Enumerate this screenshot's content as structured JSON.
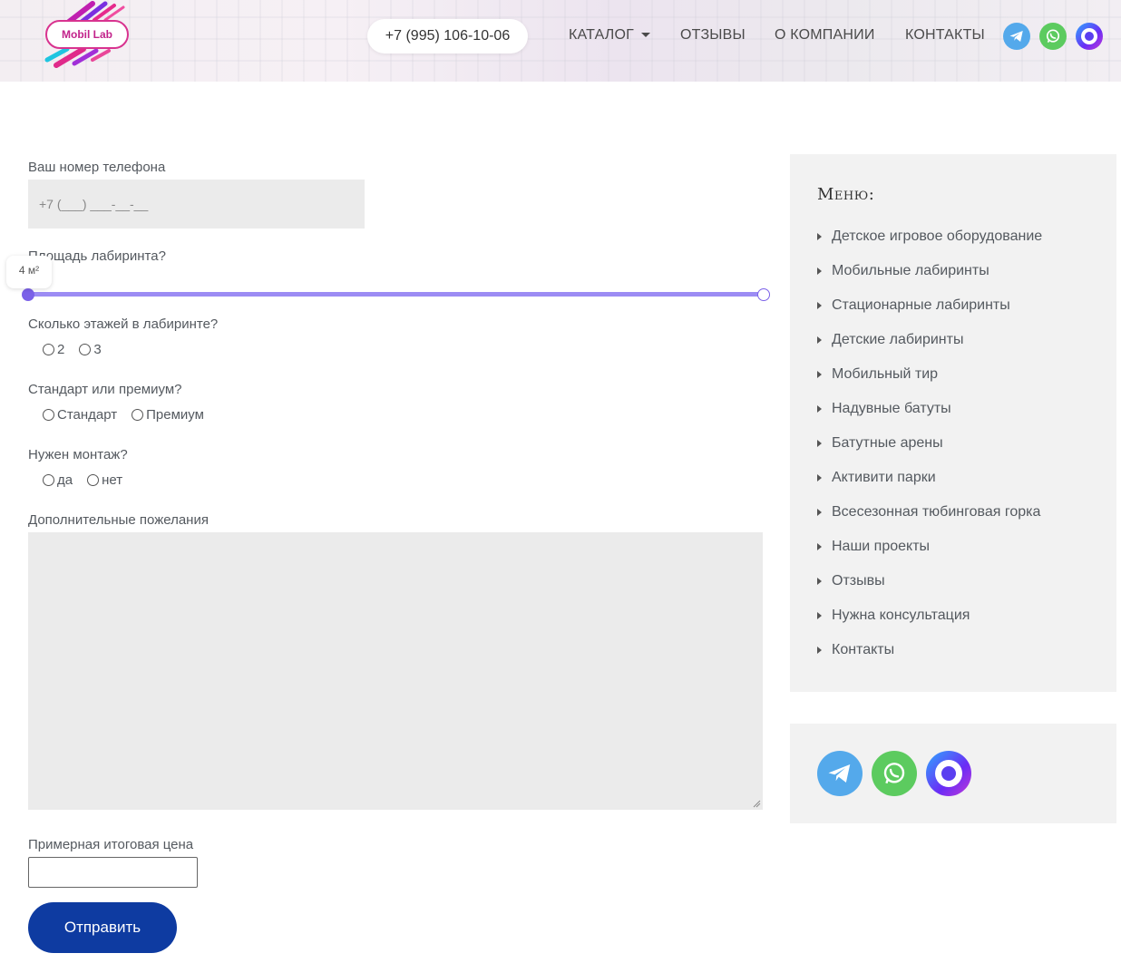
{
  "header": {
    "logo_text": "Mobil Lab",
    "phone": "+7 (995) 106-10-06",
    "nav": [
      {
        "label": "КАТАЛОГ",
        "has_dropdown": true
      },
      {
        "label": "ОТЗЫВЫ"
      },
      {
        "label": "О КОМПАНИИ"
      },
      {
        "label": "КОНТАКТЫ"
      }
    ],
    "social_icons": [
      "telegram-icon",
      "whatsapp-icon",
      "max-messenger-icon"
    ]
  },
  "form": {
    "phone_label": "Ваш номер телефона",
    "phone_placeholder": "+7 (___) ___-__-__",
    "area_label": "Площадь лабиринта?",
    "area_value": "4 м²",
    "area_slider_fraction": 0,
    "floors_label": "Сколько этажей в лабиринте?",
    "floors_options": [
      "2",
      "3"
    ],
    "tier_label": "Стандарт или премиум?",
    "tier_options": [
      "Стандарт",
      "Премиум"
    ],
    "install_label": "Нужен монтаж?",
    "install_options": [
      "да",
      "нет"
    ],
    "wishes_label": "Дополнительные пожелания",
    "price_label": "Примерная итоговая цена",
    "price_value": "",
    "submit_label": "Отправить"
  },
  "sidebar": {
    "menu_title": "Меню:",
    "menu_items": [
      "Детское игровое оборудование",
      "Мобильные лабиринты",
      "Стационарные лабиринты",
      "Детские лабиринты",
      "Мобильный тир",
      "Надувные батуты",
      "Батутные арены",
      "Активити парки",
      "Всесезонная тюбинговая горка",
      "Наши проекты",
      "Отзывы",
      "Нужна консультация",
      "Контакты"
    ]
  },
  "colors": {
    "accent_blue": "#0e3ba1",
    "slider": "#9c8cf4",
    "telegram": "#54a9eb",
    "whatsapp": "#5ccb5f"
  }
}
